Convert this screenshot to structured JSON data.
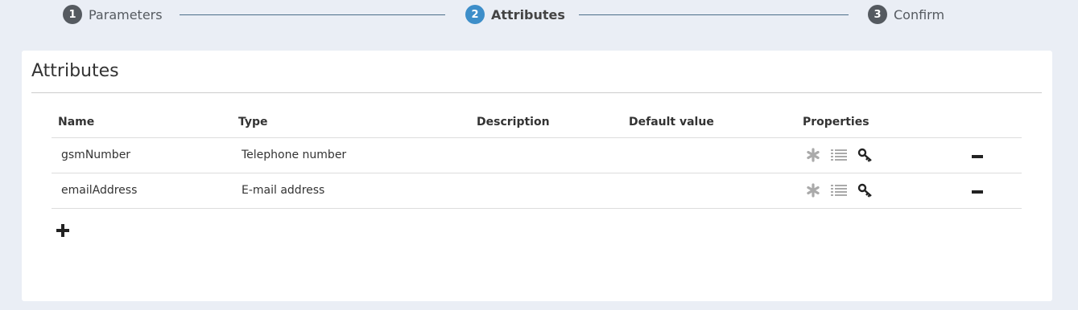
{
  "stepper": {
    "steps": [
      {
        "number": "1",
        "label": "Parameters",
        "active": false
      },
      {
        "number": "2",
        "label": "Attributes",
        "active": true
      },
      {
        "number": "3",
        "label": "Confirm",
        "active": false
      }
    ]
  },
  "card": {
    "title": "Attributes",
    "columns": {
      "name": "Name",
      "type": "Type",
      "description": "Description",
      "default_value": "Default value",
      "properties": "Properties"
    },
    "rows": [
      {
        "name": "gsmNumber",
        "type": "Telephone number",
        "description": "",
        "default_value": "",
        "properties": [
          "asterisk-icon",
          "list-icon",
          "key-icon"
        ],
        "action_icon": "minus-icon"
      },
      {
        "name": "emailAddress",
        "type": "E-mail address",
        "description": "",
        "default_value": "",
        "properties": [
          "asterisk-icon",
          "list-icon",
          "key-icon"
        ],
        "action_icon": "minus-icon"
      }
    ],
    "add_icon": "plus-icon"
  },
  "colors": {
    "background": "#eaeef5",
    "active_step": "#3d8ec9",
    "inactive_step": "#555a60",
    "muted_icon": "#aaaaaa",
    "dark_icon": "#222222"
  }
}
